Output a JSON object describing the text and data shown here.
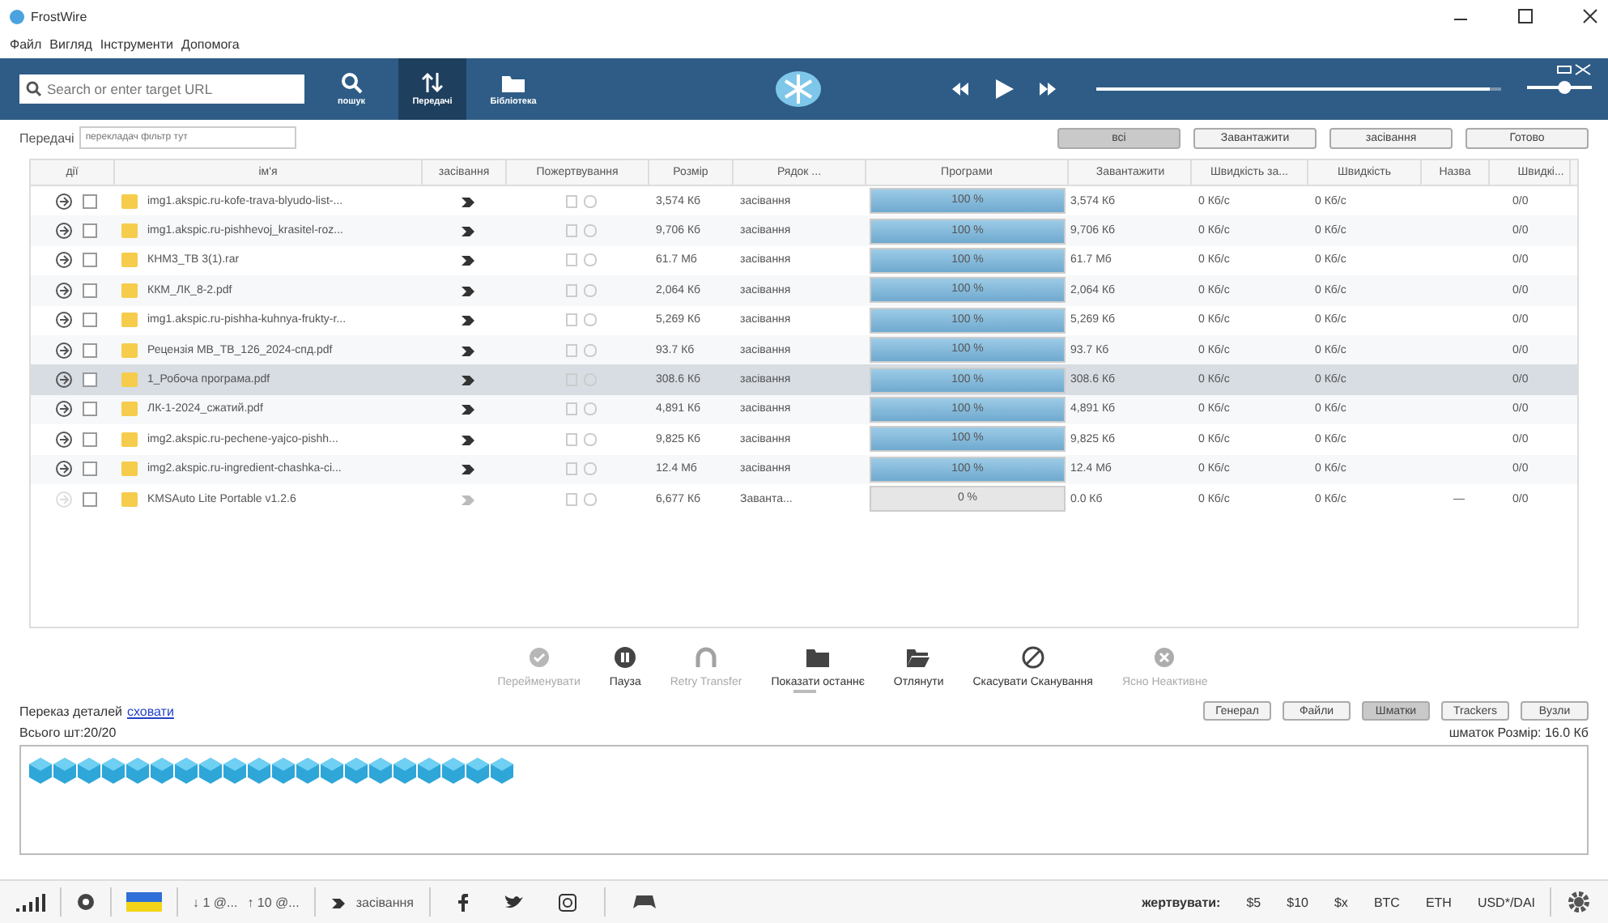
{
  "window": {
    "title": "FrostWire"
  },
  "menu": [
    "Файл",
    "Вигляд",
    "Інструменти",
    "Допомога"
  ],
  "search": {
    "placeholder": "Search or enter target URL"
  },
  "nav": [
    {
      "label": "пошук",
      "kind": "search",
      "selected": false
    },
    {
      "label": "Передачі",
      "kind": "transfers",
      "selected": true
    },
    {
      "label": "Бібліотека",
      "kind": "library",
      "selected": false
    }
  ],
  "player": {
    "level": 0.97
  },
  "volume": {
    "level": 0.6
  },
  "filter": {
    "label": "Передачі",
    "placeholder": "перекладач фільтр тут"
  },
  "filter_buttons": [
    {
      "label": "всі",
      "selected": true
    },
    {
      "label": "Завантажити",
      "selected": false
    },
    {
      "label": "засівання",
      "selected": false
    },
    {
      "label": "Готово",
      "selected": false
    }
  ],
  "table": {
    "columns": [
      "дії",
      "ім'я",
      "засівання",
      "Пожертвування",
      "Розмір",
      "Рядок ...",
      "Програми",
      "Завантажити",
      "Швидкість за...",
      "Швидкість",
      "Назва",
      "Швидкі..."
    ],
    "rows": [
      {
        "name": "img1.akspic.ru-kofe-trava-blyudo-list-...",
        "seeding": true,
        "size": "3,574 Кб",
        "status": "засівання",
        "level": 1,
        "progress": "100 %",
        "downloaded": "3,574 Кб",
        "speed_down": "0 Кб/с",
        "speed_up": "0 Кб/с",
        "column_12": "0/0",
        "selected": false
      },
      {
        "name": "img1.akspic.ru-pishhevoj_krasitel-roz...",
        "seeding": true,
        "size": "9,706 Кб",
        "status": "засівання",
        "level": 1,
        "progress": "100 %",
        "downloaded": "9,706 Кб",
        "speed_down": "0 Кб/с",
        "speed_up": "0 Кб/с",
        "column_12": "0/0",
        "selected": false
      },
      {
        "name": "КНМ3_ТВ 3(1).rar",
        "seeding": true,
        "size": "61.7 Мб",
        "status": "засівання",
        "level": 1,
        "progress": "100 %",
        "downloaded": "61.7 Мб",
        "speed_down": "0 Кб/с",
        "speed_up": "0 Кб/с",
        "column_12": "0/0",
        "selected": false
      },
      {
        "name": "ККМ_ЛК_8-2.pdf",
        "seeding": true,
        "size": "2,064 Кб",
        "status": "засівання",
        "level": 1,
        "progress": "100 %",
        "downloaded": "2,064 Кб",
        "speed_down": "0 Кб/с",
        "speed_up": "0 Кб/с",
        "column_12": "0/0",
        "selected": false
      },
      {
        "name": "img1.akspic.ru-pishha-kuhnya-frukty-r...",
        "seeding": true,
        "size": "5,269 Кб",
        "status": "засівання",
        "level": 1,
        "progress": "100 %",
        "downloaded": "5,269 Кб",
        "speed_down": "0 Кб/с",
        "speed_up": "0 Кб/с",
        "column_12": "0/0",
        "selected": false
      },
      {
        "name": "Рецензія МВ_ТВ_126_2024-спд.pdf",
        "seeding": true,
        "size": "93.7 Кб",
        "status": "засівання",
        "level": 1,
        "progress": "100 %",
        "downloaded": "93.7 Кб",
        "speed_down": "0 Кб/с",
        "speed_up": "0 Кб/с",
        "column_12": "0/0",
        "selected": false
      },
      {
        "name": "1_Робоча програма.pdf",
        "seeding": true,
        "size": "308.6 Кб",
        "status": "засівання",
        "level": 1,
        "progress": "100 %",
        "downloaded": "308.6 Кб",
        "speed_down": "0 Кб/с",
        "speed_up": "0 Кб/с",
        "column_12": "0/0",
        "selected": true
      },
      {
        "name": "ЛК-1-2024_сжатий.pdf",
        "seeding": true,
        "size": "4,891 Кб",
        "status": "засівання",
        "level": 1,
        "progress": "100 %",
        "downloaded": "4,891 Кб",
        "speed_down": "0 Кб/с",
        "speed_up": "0 Кб/с",
        "column_12": "0/0",
        "selected": false
      },
      {
        "name": "img2.akspic.ru-pechene-yajco-pishh...",
        "seeding": true,
        "size": "9,825 Кб",
        "status": "засівання",
        "level": 1,
        "progress": "100 %",
        "downloaded": "9,825 Кб",
        "speed_down": "0 Кб/с",
        "speed_up": "0 Кб/с",
        "column_12": "0/0",
        "selected": false
      },
      {
        "name": "img2.akspic.ru-ingredient-chashka-ci...",
        "seeding": true,
        "size": "12.4 Мб",
        "status": "засівання",
        "level": 1,
        "progress": "100 %",
        "downloaded": "12.4 Мб",
        "speed_down": "0 Кб/с",
        "speed_up": "0 Кб/с",
        "column_12": "0/0",
        "selected": false
      },
      {
        "name": "KMSAuto Lite Portable v1.2.6",
        "seeding": false,
        "size": "6,677 Кб",
        "status": "Заванта...",
        "level": 0,
        "progress": "0 %",
        "downloaded": "0.0 Кб",
        "speed_down": "0 Кб/с",
        "speed_up": "0 Кб/с",
        "column_11": "—",
        "column_12": "0/0",
        "selected": false
      }
    ]
  },
  "actions": [
    {
      "label": "Перейменувати",
      "kind": "check",
      "disabled": true
    },
    {
      "label": "Пауза",
      "kind": "pause",
      "disabled": false
    },
    {
      "label": "Retry Transfer",
      "kind": "magnet",
      "disabled": true
    },
    {
      "label": "Показати останнє",
      "kind": "folder",
      "disabled": false
    },
    {
      "label": "Отлянути",
      "kind": "folder-open",
      "disabled": false
    },
    {
      "label": "Скасувати Сканування",
      "kind": "cancel",
      "disabled": false
    },
    {
      "label": "Ясно Неактивне",
      "kind": "clear",
      "disabled": true
    }
  ],
  "details": {
    "label": "Переказ деталей",
    "link": "сховати",
    "total": "Всього шт:20/20",
    "piece_size": "шматок Розмір: 16.0 Кб",
    "tabs": [
      {
        "label": "Генерал",
        "selected": false
      },
      {
        "label": "Файли",
        "selected": false
      },
      {
        "label": "Шматки",
        "selected": true
      },
      {
        "label": "Trackers",
        "selected": false
      },
      {
        "label": "Вузли",
        "selected": false
      }
    ],
    "pieces": [
      {
        "done": true
      },
      {
        "done": true
      },
      {
        "done": true
      },
      {
        "done": true
      },
      {
        "done": true
      },
      {
        "done": true
      },
      {
        "done": true
      },
      {
        "done": true
      },
      {
        "done": true
      },
      {
        "done": true
      },
      {
        "done": true
      },
      {
        "done": true
      },
      {
        "done": true
      },
      {
        "done": true
      },
      {
        "done": true
      },
      {
        "done": true
      },
      {
        "done": true
      },
      {
        "done": true
      },
      {
        "done": true
      },
      {
        "done": true
      }
    ]
  },
  "status_bar": {
    "down": "↓ 1 @...",
    "up": "↑ 10 @...",
    "seeding": "засівання",
    "donate_label": "жертвувати:",
    "donations": [
      "$5",
      "$10",
      "$x",
      "BTC",
      "ETH",
      "USD*/DAI"
    ]
  }
}
